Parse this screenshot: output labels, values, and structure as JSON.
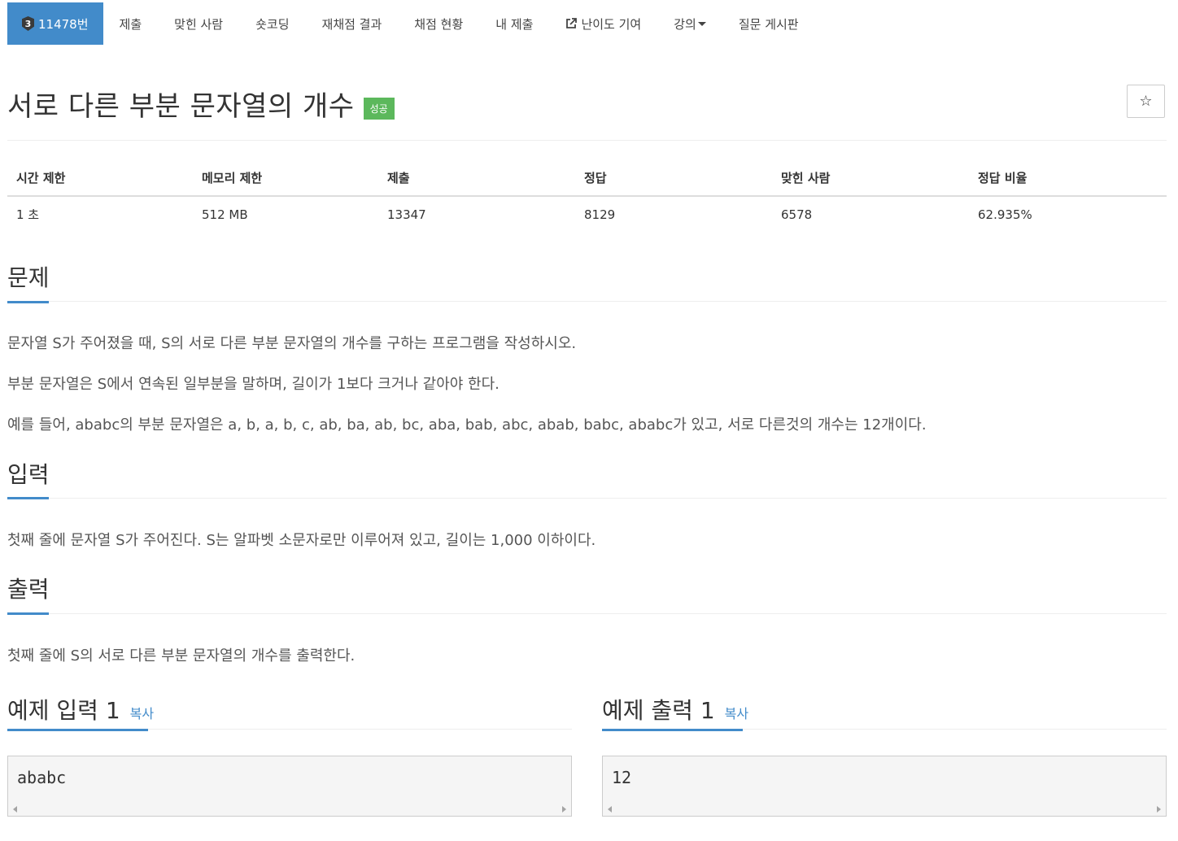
{
  "nav": {
    "problem_tier": "3",
    "problem_number": "11478번",
    "items": [
      "제출",
      "맞힌 사람",
      "숏코딩",
      "재채점 결과",
      "채점 현황",
      "내 제출",
      "난이도 기여",
      "강의",
      "질문 게시판"
    ]
  },
  "problem": {
    "title": "서로 다른 부분 문자열의 개수",
    "status_badge": "성공",
    "star_icon": "☆"
  },
  "info": {
    "headers": [
      "시간 제한",
      "메모리 제한",
      "제출",
      "정답",
      "맞힌 사람",
      "정답 비율"
    ],
    "values": [
      "1 초",
      "512 MB",
      "13347",
      "8129",
      "6578",
      "62.935%"
    ]
  },
  "sections": {
    "description": {
      "heading": "문제",
      "paragraphs": [
        "문자열 S가 주어졌을 때, S의 서로 다른 부분 문자열의 개수를 구하는 프로그램을 작성하시오.",
        "부분 문자열은 S에서 연속된 일부분을 말하며, 길이가 1보다 크거나 같아야 한다.",
        "예를 들어, ababc의 부분 문자열은 a, b, a, b, c, ab, ba, ab, bc, aba, bab, abc, abab, babc, ababc가 있고, 서로 다른것의 개수는 12개이다."
      ]
    },
    "input": {
      "heading": "입력",
      "text": "첫째 줄에 문자열 S가 주어진다. S는 알파벳 소문자로만 이루어져 있고, 길이는 1,000 이하이다."
    },
    "output": {
      "heading": "출력",
      "text": "첫째 줄에 S의 서로 다른 부분 문자열의 개수를 출력한다."
    }
  },
  "samples": {
    "input_heading": "예제 입력 1",
    "output_heading": "예제 출력 1",
    "copy_label": "복사",
    "input_value": "ababc",
    "output_value": "12"
  },
  "colors": {
    "accent": "#428bca",
    "success": "#5cb85c"
  }
}
